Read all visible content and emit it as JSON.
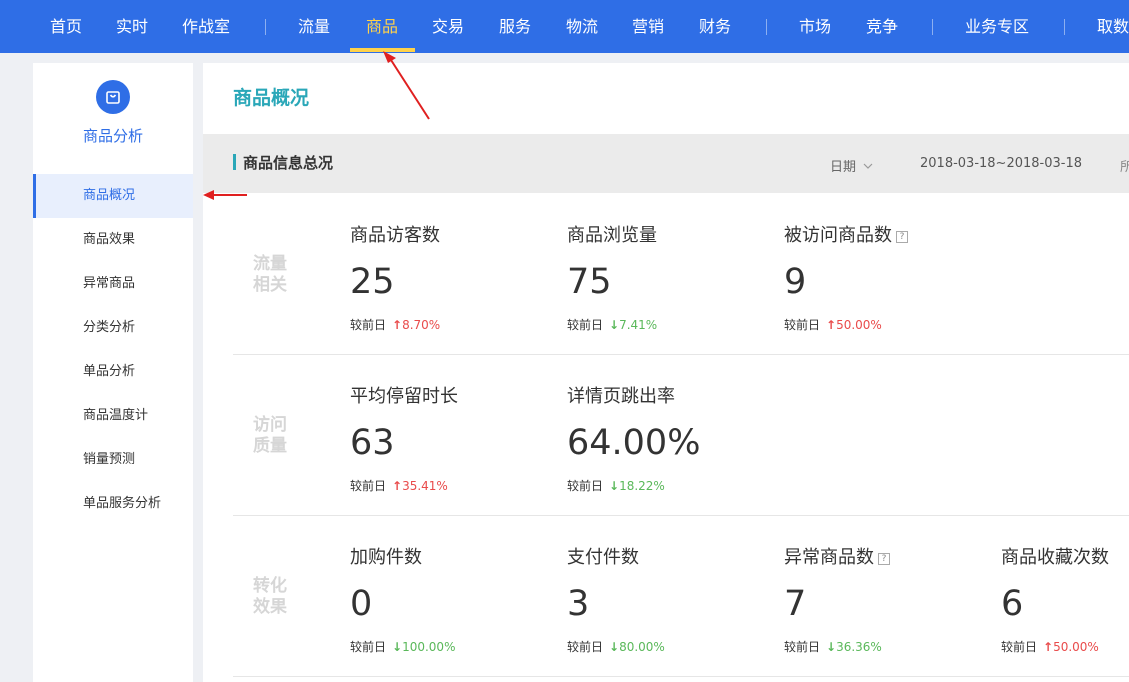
{
  "topnav": {
    "items": [
      "首页",
      "实时",
      "作战室",
      "流量",
      "商品",
      "交易",
      "服务",
      "物流",
      "营销",
      "财务",
      "市场",
      "竞争",
      "业务专区",
      "取数"
    ],
    "active_index": 4,
    "active_color": "#ffd24a",
    "bg_color": "#2f6ee6"
  },
  "sidebar": {
    "icon": "shopping-bag-icon",
    "title": "商品分析",
    "items": [
      "商品概况",
      "商品效果",
      "异常商品",
      "分类分析",
      "单品分析",
      "商品温度计",
      "销量预测",
      "单品服务分析"
    ],
    "active_index": 0
  },
  "page": {
    "title": "商品概况",
    "section_title": "商品信息总况",
    "date_label": "日期",
    "date_range": "2018-03-18~2018-03-18",
    "cut_text": "所"
  },
  "groups": [
    {
      "label": "流量相关",
      "metrics": [
        {
          "name": "商品访客数",
          "value": "25",
          "cmp_label": "较前日",
          "change": "8.70%",
          "direction": "up",
          "help": false
        },
        {
          "name": "商品浏览量",
          "value": "75",
          "cmp_label": "较前日",
          "change": "7.41%",
          "direction": "down",
          "help": false
        },
        {
          "name": "被访问商品数",
          "value": "9",
          "cmp_label": "较前日",
          "change": "50.00%",
          "direction": "up",
          "help": true
        }
      ]
    },
    {
      "label": "访问质量",
      "metrics": [
        {
          "name": "平均停留时长",
          "value": "63",
          "cmp_label": "较前日",
          "change": "35.41%",
          "direction": "up",
          "help": false
        },
        {
          "name": "详情页跳出率",
          "value": "64.00%",
          "cmp_label": "较前日",
          "change": "18.22%",
          "direction": "down",
          "help": false
        }
      ]
    },
    {
      "label": "转化效果",
      "metrics": [
        {
          "name": "加购件数",
          "value": "0",
          "cmp_label": "较前日",
          "change": "100.00%",
          "direction": "down",
          "help": false
        },
        {
          "name": "支付件数",
          "value": "3",
          "cmp_label": "较前日",
          "change": "80.00%",
          "direction": "down",
          "help": false
        },
        {
          "name": "异常商品数",
          "value": "7",
          "cmp_label": "较前日",
          "change": "36.36%",
          "direction": "down",
          "help": true
        },
        {
          "name": "商品收藏次数",
          "value": "6",
          "cmp_label": "较前日",
          "change": "50.00%",
          "direction": "up",
          "help": false
        }
      ]
    }
  ],
  "help_glyph": "?",
  "arrow_up_glyph": "↑",
  "arrow_down_glyph": "↓"
}
